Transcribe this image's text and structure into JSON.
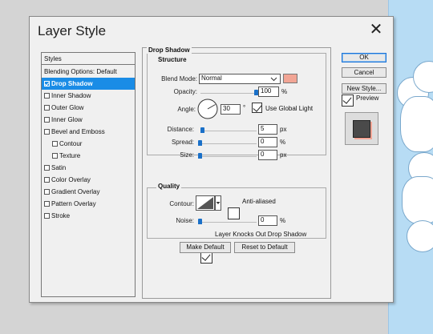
{
  "dialog": {
    "title": "Layer Style",
    "close_glyph": "✕"
  },
  "styles_list": {
    "header": "Styles",
    "items": [
      {
        "label": "Blending Options: Default",
        "checkbox": false,
        "selected": false,
        "checked": false
      },
      {
        "label": "Drop Shadow",
        "checkbox": true,
        "selected": true,
        "checked": true
      },
      {
        "label": "Inner Shadow",
        "checkbox": true,
        "selected": false,
        "checked": false
      },
      {
        "label": "Outer Glow",
        "checkbox": true,
        "selected": false,
        "checked": false
      },
      {
        "label": "Inner Glow",
        "checkbox": true,
        "selected": false,
        "checked": false
      },
      {
        "label": "Bevel and Emboss",
        "checkbox": true,
        "selected": false,
        "checked": false
      },
      {
        "label": "Contour",
        "checkbox": true,
        "selected": false,
        "checked": false,
        "sub": true
      },
      {
        "label": "Texture",
        "checkbox": true,
        "selected": false,
        "checked": false,
        "sub": true
      },
      {
        "label": "Satin",
        "checkbox": true,
        "selected": false,
        "checked": false
      },
      {
        "label": "Color Overlay",
        "checkbox": true,
        "selected": false,
        "checked": false
      },
      {
        "label": "Gradient Overlay",
        "checkbox": true,
        "selected": false,
        "checked": false
      },
      {
        "label": "Pattern Overlay",
        "checkbox": true,
        "selected": false,
        "checked": false
      },
      {
        "label": "Stroke",
        "checkbox": true,
        "selected": false,
        "checked": false
      }
    ]
  },
  "drop_shadow": {
    "section_title": "Drop Shadow",
    "structure_title": "Structure",
    "blend_mode_label": "Blend Mode:",
    "blend_mode_value": "Normal",
    "shadow_color": "#f2a595",
    "opacity_label": "Opacity:",
    "opacity_value": "100",
    "opacity_unit": "%",
    "opacity_fraction": 1.0,
    "angle_label": "Angle:",
    "angle_value": "30",
    "angle_unit": "°",
    "use_global_light_label": "Use Global Light",
    "use_global_light_checked": true,
    "distance_label": "Distance:",
    "distance_value": "5",
    "distance_unit": "px",
    "spread_label": "Spread:",
    "spread_value": "0",
    "spread_unit": "%",
    "size_label": "Size:",
    "size_value": "0",
    "size_unit": "px",
    "quality_title": "Quality",
    "contour_label": "Contour:",
    "anti_aliased_label": "Anti-aliased",
    "anti_aliased_checked": false,
    "noise_label": "Noise:",
    "noise_value": "0",
    "noise_unit": "%",
    "knocks_out_label": "Layer Knocks Out Drop Shadow",
    "knocks_out_checked": true,
    "make_default_label": "Make Default",
    "reset_default_label": "Reset to Default"
  },
  "right_buttons": {
    "ok_label": "OK",
    "cancel_label": "Cancel",
    "new_style_label": "New Style...",
    "preview_label": "Preview",
    "preview_checked": true
  },
  "colors": {
    "accent": "#1a8ce6",
    "shadow_color": "#f2a595",
    "preview_swatch": "#4a4a4a"
  }
}
